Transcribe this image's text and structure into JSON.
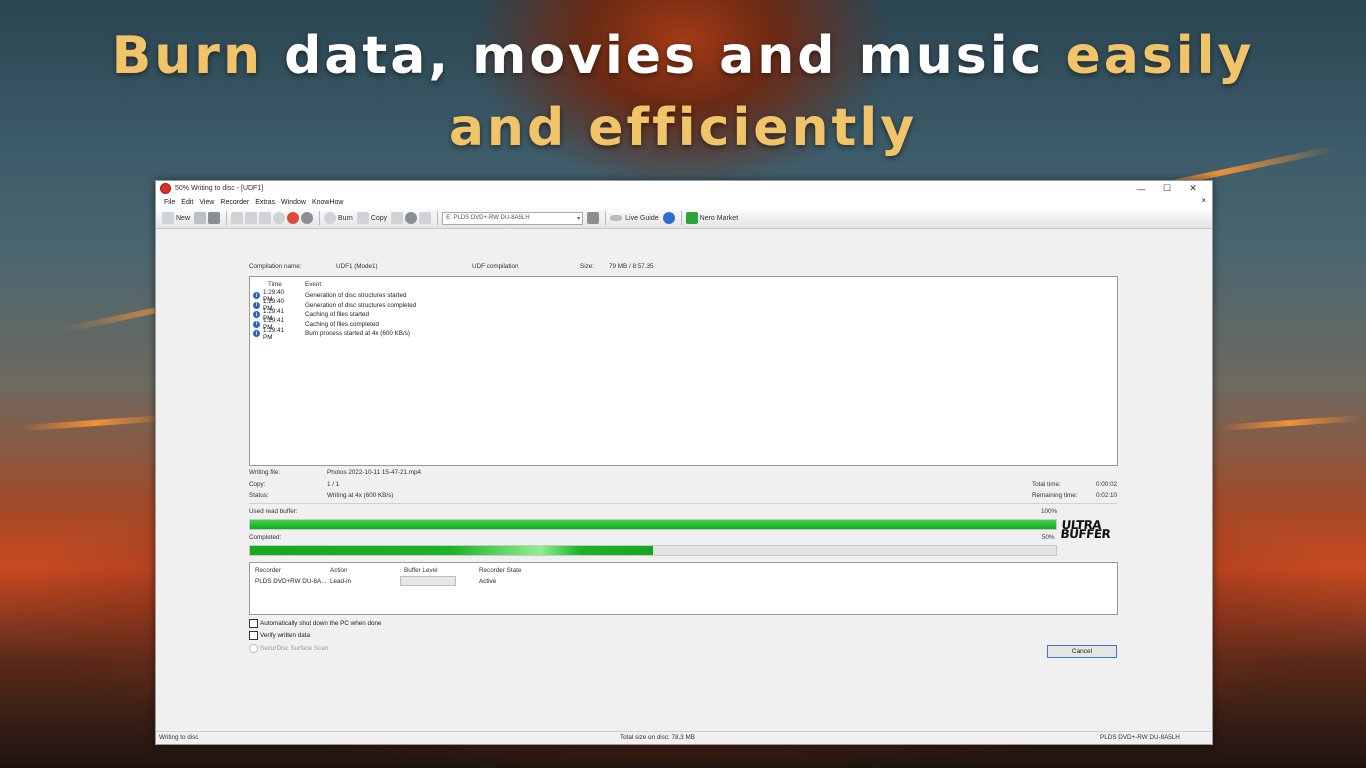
{
  "banner": {
    "line1": [
      {
        "text": "Burn ",
        "color": "gold"
      },
      {
        "text": "data, movies and music ",
        "color": "white"
      },
      {
        "text": "easily",
        "color": "gold"
      }
    ],
    "line2": "and efficiently"
  },
  "window": {
    "title": "50% Writing to disc - [UDF1]",
    "controls": {
      "minimize": "—",
      "maximize": "☐",
      "close": "✕"
    },
    "mdi_close": "×"
  },
  "menu": [
    "File",
    "Edit",
    "View",
    "Recorder",
    "Extras",
    "Window",
    "KnowHow"
  ],
  "toolbar": {
    "new_label": "New",
    "burn_label": "Burn",
    "copy_label": "Copy",
    "drive": "E: PLDS DVD+-RW DU-8A5LH",
    "live_guide_label": "Live Guide",
    "market_label": "Nero Market"
  },
  "compilation": {
    "name_label": "Compilation name:",
    "name_value": "UDF1 (Mode1)",
    "type": "UDF compilation",
    "size_label": "Size:",
    "size_value": "79 MB  /  8:57.35"
  },
  "events": {
    "header_time": "Time",
    "header_event": "Event",
    "rows": [
      {
        "time": "1:29:40 PM",
        "event": "Generation of disc structures started"
      },
      {
        "time": "1:29:40 PM",
        "event": "Generation of disc structures completed"
      },
      {
        "time": "1:29:41 PM",
        "event": "Caching of files started"
      },
      {
        "time": "1:29:41 PM",
        "event": "Caching of files completed"
      },
      {
        "time": "1:29:41 PM",
        "event": "Burn process started at 4x (600 KB/s)"
      }
    ]
  },
  "progress": {
    "writing_file_label": "Writing file:",
    "writing_file_value": "Photos 2022-10-11 15-47-21.mp4",
    "copy_label": "Copy:",
    "copy_value": "1 / 1",
    "status_label": "Status:",
    "status_value": "Writing at 4x (600 KB/s)",
    "total_time_label": "Total time:",
    "total_time_value": "0:00:02",
    "remaining_label": "Remaining time:",
    "remaining_value": "0:02:10",
    "buffer_label": "Used read buffer:",
    "buffer_pct_text": "100%",
    "buffer_fraction": 1.0,
    "completed_label": "Completed:",
    "completed_pct_text": "50%",
    "completed_fraction": 0.5,
    "logo_line1": "ULTRA",
    "logo_line2": "BUFFER"
  },
  "recorder_table": {
    "headers": [
      "Recorder",
      "Action",
      "Buffer Level",
      "Recorder State"
    ],
    "row": {
      "recorder": "PLDS DVD+RW DU-8A...",
      "action": "Lead-in",
      "state": "Active"
    }
  },
  "options": {
    "shutdown": "Automatically shut down the PC when done",
    "verify": "Verify written data",
    "securdisc": "SecurDisc Surface Scan"
  },
  "cancel_label": "Cancel",
  "statusbar": {
    "left": "Writing to disc",
    "center": "Total size on disc: 78.3 MB",
    "right": "PLDS    DVD+-RW DU-8A5LH"
  }
}
